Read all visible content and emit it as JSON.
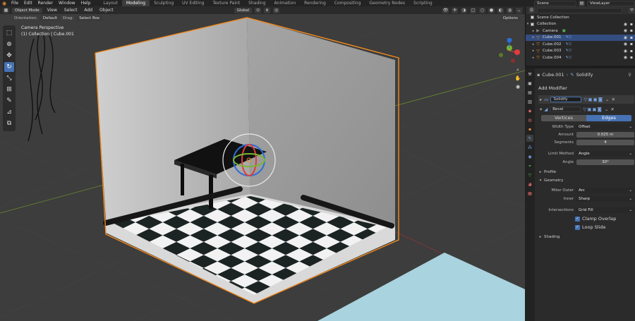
{
  "topbar": {
    "menus": [
      "File",
      "Edit",
      "Render",
      "Window",
      "Help"
    ],
    "tabs": [
      "Layout",
      "Modeling",
      "Sculpting",
      "UV Editing",
      "Texture Paint",
      "Shading",
      "Animation",
      "Rendering",
      "Compositing",
      "Geometry Nodes",
      "Scripting"
    ],
    "active_tab": "Modeling",
    "scene": "Scene",
    "view_layer": "ViewLayer"
  },
  "viewport_header": {
    "mode": "Object Mode",
    "menus": [
      "View",
      "Select",
      "Add",
      "Object"
    ],
    "transform": "Global"
  },
  "tool_options": {
    "orientation_label": "Orientation:",
    "orientation": "Default",
    "drag_label": "Drag:",
    "drag": "Select Box",
    "options": "Options"
  },
  "overlay": {
    "camera": "Camera Perspective",
    "collection": "(1) Collection | Cube.001"
  },
  "outliner": {
    "rows": [
      {
        "label": "Scene Collection",
        "icon": "collection-icon"
      },
      {
        "label": "Collection",
        "icon": "collection-icon"
      },
      {
        "label": "Camera",
        "icon": "camera-icon"
      },
      {
        "label": "Cube.001",
        "icon": "mesh-icon"
      },
      {
        "label": "Cube.002",
        "icon": "mesh-icon"
      },
      {
        "label": "Cube.003",
        "icon": "mesh-icon"
      },
      {
        "label": "Cube.004",
        "icon": "mesh-icon"
      }
    ]
  },
  "properties": {
    "object": "Cube.001",
    "modifier_context": "Solidify",
    "add_modifier": "Add Modifier",
    "mod1": "Solidify",
    "mod2": "Bevel",
    "tab_vertices": "Vertices",
    "tab_edges": "Edges",
    "width_type_label": "Width Type",
    "width_type": "Offset",
    "amount_label": "Amount",
    "amount": "0.025 m",
    "segments_label": "Segments",
    "segments": "4",
    "limit_method_label": "Limit Method",
    "limit_method": "Angle",
    "angle_label": "Angle",
    "angle": "30°",
    "profile": "Profile",
    "geometry": "Geometry",
    "miter_outer_label": "Miter Outer",
    "miter_outer": "Arc",
    "inner_label": "Inner",
    "inner": "Sharp",
    "intersections_label": "Intersections",
    "intersections": "Grid Fill",
    "clamp_overlap": "Clamp Overlap",
    "loop_slide": "Loop Slide",
    "shading": "Shading"
  },
  "colors": {
    "accent": "#4772b3",
    "selection_outline": "#f08a1e",
    "viewport_bg": "#3d3d3d"
  }
}
